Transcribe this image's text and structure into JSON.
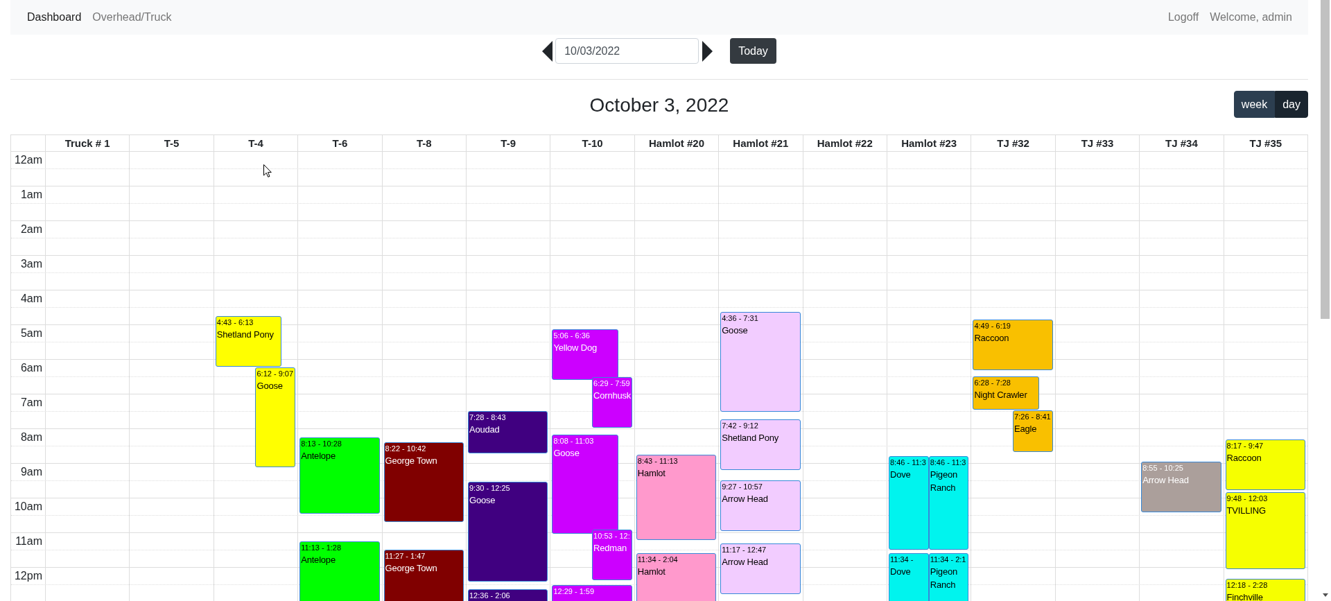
{
  "navbar": {
    "links": [
      {
        "label": "Dashboard",
        "selected": true
      },
      {
        "label": "Overhead/Truck",
        "selected": false
      }
    ],
    "logoff": "Logoff",
    "greeting": "Welcome, admin"
  },
  "date_nav": {
    "date_field": {
      "value": "10/03/2022"
    },
    "today_button": "Today"
  },
  "calendar": {
    "title": "October 3, 2022",
    "views": [
      {
        "label": "week",
        "selected": false
      },
      {
        "label": "day",
        "selected": true
      }
    ],
    "time_labels": [
      "12am",
      "1am",
      "2am",
      "3am",
      "4am",
      "5am",
      "6am",
      "7am",
      "8am",
      "9am",
      "10am",
      "11am",
      "12pm"
    ],
    "resources": [
      {
        "name": "Truck # 1"
      },
      {
        "name": "T-5"
      },
      {
        "name": "T-4",
        "events": [
          {
            "time": "4:43 - 6:13",
            "title": "Shetland Pony",
            "color": "#ffff00"
          },
          {
            "time": "6:12 - 9:07",
            "title": "Goose",
            "color": "#ffff00"
          }
        ]
      },
      {
        "name": "T-6",
        "events": [
          {
            "time": "8:13 - 10:28",
            "title": "Antelope",
            "color": "#00ff00"
          },
          {
            "time": "11:13 - 1:28",
            "title": "Antelope",
            "color": "#00ff00"
          }
        ]
      },
      {
        "name": "T-8",
        "events": [
          {
            "time": "8:22 - 10:42",
            "title": "George Town",
            "color": "#800000"
          },
          {
            "time": "11:27 - 1:47",
            "title": "George Town",
            "color": "#800000"
          }
        ]
      },
      {
        "name": "T-9",
        "events": [
          {
            "time": "7:28 - 8:43",
            "title": "Aoudad",
            "color": "#400080"
          },
          {
            "time": "9:30 - 12:25",
            "title": "Goose",
            "color": "#400080"
          },
          {
            "time": "12:36 - 2:06",
            "color": "#400080"
          }
        ]
      },
      {
        "name": "T-10",
        "events": [
          {
            "time": "5:06 - 6:36",
            "title": "Yellow Dog",
            "color": "#cc00ff"
          },
          {
            "time": "6:29 - 7:59",
            "title": "Cornhusk",
            "color": "#cc00ff"
          },
          {
            "time": "8:08 - 11:03",
            "title": "Goose",
            "color": "#cc00ff"
          },
          {
            "time": "10:53 - 12:",
            "title": "Redman",
            "color": "#cc00ff"
          },
          {
            "time": "12:29 - 1:59",
            "color": "#cc00ff"
          }
        ]
      },
      {
        "name": "Hamlot #20",
        "events": [
          {
            "time": "8:43 - 11:13",
            "title": "Hamlot",
            "color": "#ff99cc"
          },
          {
            "time": "11:34 - 2:04",
            "title": "Hamlot",
            "color": "#ff99cc"
          }
        ]
      },
      {
        "name": "Hamlot #21",
        "events": [
          {
            "time": "4:36 - 7:31",
            "title": "Goose",
            "color": "#f2ccff"
          },
          {
            "time": "7:42 - 9:12",
            "title": "Shetland Pony",
            "color": "#f2ccff"
          },
          {
            "time": "9:27 - 10:57",
            "title": "Arrow Head",
            "color": "#f2ccff"
          },
          {
            "time": "11:17 - 12:47",
            "title": "Arrow Head",
            "color": "#f2ccff"
          }
        ]
      },
      {
        "name": "Hamlot #22"
      },
      {
        "name": "Hamlot #23",
        "events": [
          {
            "time": "8:46 - 11:3",
            "title": "Dove",
            "color": "#00f4ee"
          },
          {
            "time": "8:46 - 11:3",
            "title": "Pigeon Ranch",
            "color": "#00f4ee"
          },
          {
            "time": "11:34 -",
            "title": "Dove",
            "color": "#00f4ee"
          },
          {
            "time": "11:34 - 2:1",
            "title": "Pigeon Ranch",
            "color": "#00f4ee"
          }
        ]
      },
      {
        "name": "TJ #32",
        "events": [
          {
            "time": "4:49 - 6:19",
            "title": "Raccoon",
            "color": "#f9c000"
          },
          {
            "time": "6:28 - 7:28",
            "title": "Night Crawler",
            "color": "#f9c000"
          },
          {
            "time": "7:26 - 8:41",
            "title": "Eagle",
            "color": "#f9c000"
          }
        ]
      },
      {
        "name": "TJ #33"
      },
      {
        "name": "TJ #34",
        "events": [
          {
            "time": "8:55 - 10:25",
            "title": "Arrow Head",
            "color": "#ab9f9b"
          }
        ]
      },
      {
        "name": "TJ #35",
        "events": [
          {
            "time": "8:17 - 9:47",
            "title": "Raccoon",
            "color": "#f6ff00"
          },
          {
            "time": "9:48 - 12:03",
            "title": "TVILLING",
            "color": "#f6ff00"
          },
          {
            "time": "12:18 - 2:28",
            "title": "Finchville",
            "color": "#f6ff00"
          }
        ]
      }
    ]
  }
}
